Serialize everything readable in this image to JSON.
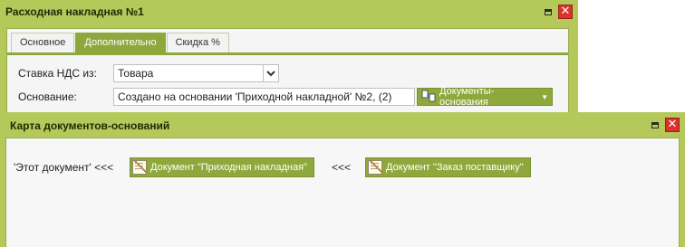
{
  "main_window": {
    "title": "Расходная накладная №1",
    "minimize_glyph": "",
    "close_glyph": "✕",
    "tabs": [
      {
        "label": "Основное",
        "active": false
      },
      {
        "label": "Дополнительно",
        "active": true
      },
      {
        "label": "Скидка %",
        "active": false
      }
    ],
    "vat_label": "Ставка НДС из:",
    "vat_value": "Товара",
    "basis_label": "Основание:",
    "basis_value": "Создано на основании 'Приходной накладной' №2, (2)",
    "documents_button": "Документы-основания",
    "icons": {
      "combo_arrow": "chevron-down-icon",
      "documents_button": "link-documents-icon",
      "dropdown": "caret-down-icon"
    }
  },
  "map_window": {
    "title": "Карта документов-оснований",
    "close_glyph": "✕",
    "this_document": "'Этот документ' <<<",
    "separator": "<<<",
    "doc_buttons": [
      {
        "label": "Документ \"Приходная накладная\""
      },
      {
        "label": "Документ \"Заказ поставщику\""
      }
    ]
  },
  "colors": {
    "accent": "#8ea83c",
    "window_frame": "#b4c95a",
    "close": "#d9332b"
  }
}
